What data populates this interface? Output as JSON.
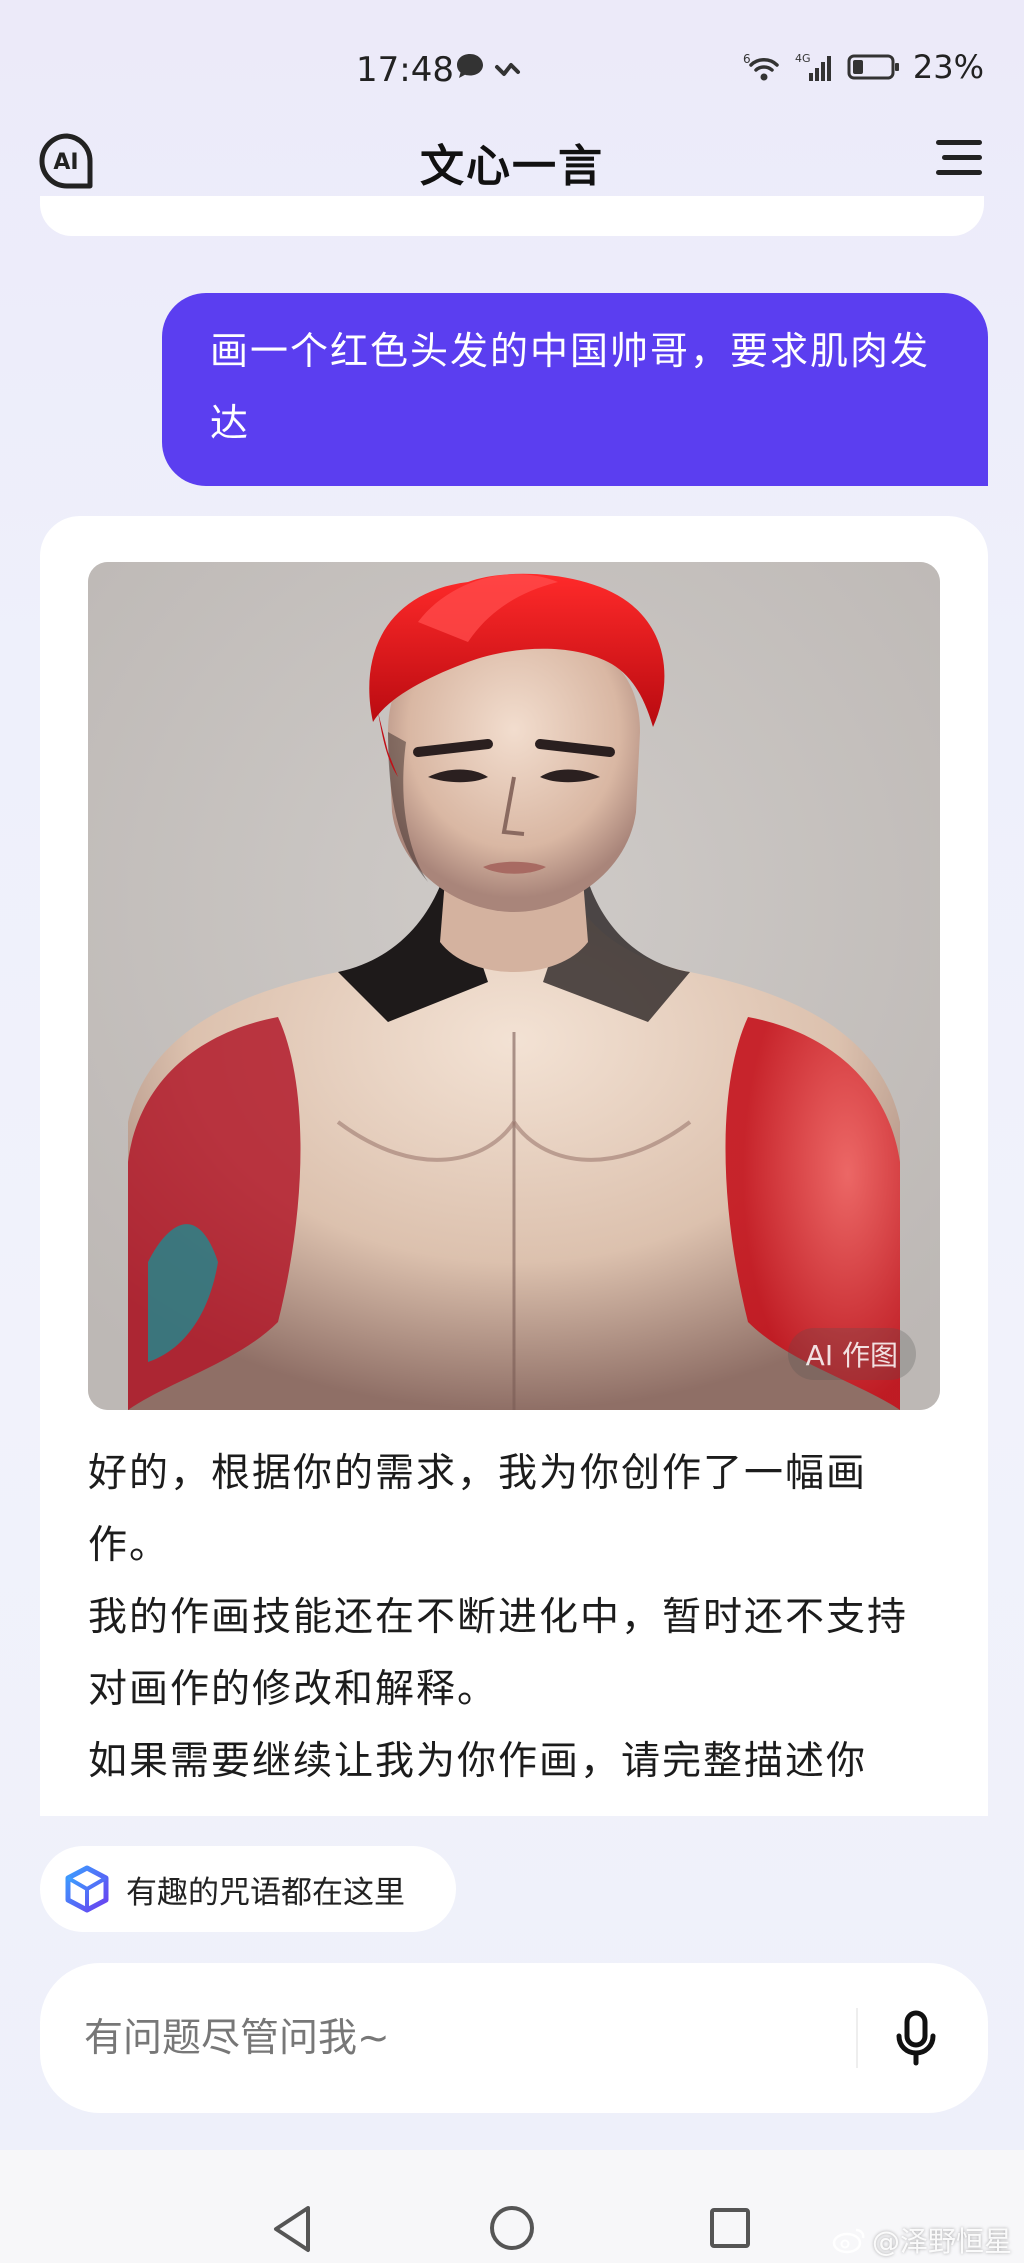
{
  "status_bar": {
    "time": "17:48",
    "battery": "23%",
    "network_label": "4G",
    "wifi_label": "6"
  },
  "header": {
    "title": "文心一言",
    "logo_text": "AI"
  },
  "conversation": {
    "user_message": "画一个红色头发的中国帅哥，要求肌肉发达",
    "ai_image_tag": "AI 作图",
    "ai_paragraphs": [
      "好的，根据你的需求，我为你创作了一幅画作。",
      "我的作画技能还在不断进化中，暂时还不支持对画作的修改和解释。",
      "如果需要继续让我为你作画，请完整描述你"
    ]
  },
  "suggestion_chip": {
    "label": "有趣的咒语都在这里"
  },
  "input": {
    "placeholder": "有问题尽管问我~"
  },
  "credit": {
    "text": "@泽野恒星"
  },
  "colors": {
    "accent": "#5b3ef0",
    "hair_red": "#e0141a"
  }
}
